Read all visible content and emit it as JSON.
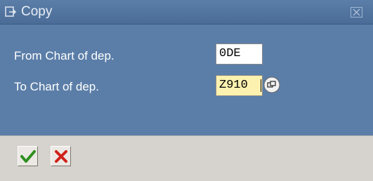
{
  "window": {
    "title": "Copy",
    "title_icon": "copy-icon",
    "close_icon": "close-icon"
  },
  "form": {
    "from_label": "From Chart of dep.",
    "from_value": "0DE",
    "to_label": "To Chart of dep.",
    "to_value": "Z910",
    "search_help_icon": "search-help-icon"
  },
  "toolbar": {
    "confirm_icon": "checkmark-icon",
    "cancel_icon": "x-icon"
  },
  "colors": {
    "title_bar": "#4a6c97",
    "content_bg": "#5b7ea8",
    "toolbar_bg": "#d6d3ce",
    "required_field_bg": "#fdf1b0",
    "confirm_green": "#2f8f1f",
    "cancel_red": "#d0211a"
  }
}
